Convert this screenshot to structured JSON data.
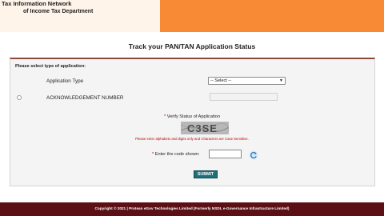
{
  "header": {
    "line1": "Tax Information Network",
    "line2": "of Income Tax Department",
    "brand_color": "#f98a35"
  },
  "page_title": "Track your PAN/TAN Application Status",
  "form": {
    "select_type_label": "Please select type of application:",
    "application_type_label": "Application Type",
    "application_type_value": "-- Select --",
    "ack_label": "ACKNOWLEDGEMENT NUMBER",
    "ack_value": "",
    "verify_star": "*",
    "verify_label": "Verify Status of Application",
    "captcha_text": "C3SE",
    "captcha_note": "Please enter alphabets and digits only and Characters are Case Sensitive.",
    "code_star": "*",
    "code_label": "Enter the code shown:",
    "code_value": "",
    "submit_label": "SUBMIT",
    "refresh_icon": "refresh-icon"
  },
  "footer": {
    "text": "Copyright © 2021 | Protean eGov Technologies Limited (Formerly NSDL e-Governance Infrastructure Limited)",
    "color": "#5c0f14"
  }
}
